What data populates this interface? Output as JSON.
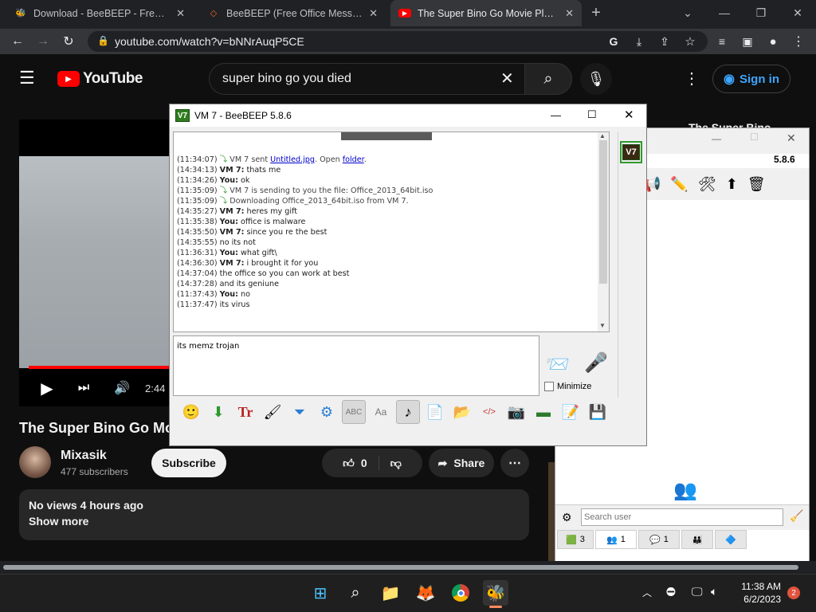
{
  "browser": {
    "tabs": [
      {
        "title": "Download - BeeBEEP - Free Offic",
        "active": false,
        "icon": "beebeep-icon"
      },
      {
        "title": "BeeBEEP (Free Office Messenger)",
        "active": false,
        "icon": "sourceforge-icon"
      },
      {
        "title": "The Super Bino Go Movie Plane",
        "active": true,
        "icon": "youtube-icon"
      }
    ],
    "url": "youtube.com/watch?v=bNNrAuqP5CE"
  },
  "youtube": {
    "logo": "YouTube",
    "search_value": "super bino go you died",
    "sign_in": "Sign in",
    "time": "2:44",
    "video_title": "The Super Bino Go Mo",
    "channel": "Mixasik",
    "subscribers": "477 subscribers",
    "subscribe": "Subscribe",
    "likes": "0",
    "share": "Share",
    "views": "No views  4 hours ago",
    "show_more": "Show more",
    "right_title": "The Super Bino"
  },
  "chat": {
    "title": "VM 7 - BeeBEEP 5.8.6",
    "badge": "V7",
    "messages": [
      {
        "ts": "(11:34:07)",
        "type": "sys",
        "pre": "VM 7 sent ",
        "link1": "Untitled.jpg",
        "mid": ". Open ",
        "link2": "folder",
        "post": "."
      },
      {
        "ts": "(14:34:13)",
        "who": "VM 7:",
        "text": "thats me"
      },
      {
        "ts": "(11:34:26)",
        "who": "You:",
        "text": "ok"
      },
      {
        "ts": "(11:35:09)",
        "type": "sys",
        "pre": "VM 7 is sending to you the file: Office_2013_64bit.iso"
      },
      {
        "ts": "(11:35:09)",
        "type": "sys",
        "pre": "Downloading Office_2013_64bit.iso from VM 7."
      },
      {
        "ts": "(14:35:27)",
        "who": "VM 7:",
        "text": "heres my gift"
      },
      {
        "ts": "(11:35:38)",
        "who": "You:",
        "text": "office is malware"
      },
      {
        "ts": "(14:35:50)",
        "who": "VM 7:",
        "text": "since you re the best"
      },
      {
        "ts": "(14:35:55)",
        "who": "",
        "text": "no its not"
      },
      {
        "ts": "(11:36:31)",
        "who": "You:",
        "text": "what gift\\"
      },
      {
        "ts": "(14:36:30)",
        "who": "VM 7:",
        "text": "i brought it for you"
      },
      {
        "ts": "(14:37:04)",
        "who": "",
        "text": "the office so you can work at best"
      },
      {
        "ts": "(14:37:28)",
        "who": "",
        "text": "and its geniune"
      },
      {
        "ts": "(11:37:43)",
        "who": "You:",
        "text": "no"
      },
      {
        "ts": "(11:37:47)",
        "who": "",
        "text": "its virus"
      }
    ],
    "input_value": "its memz trojan",
    "minimize_label": "Minimize"
  },
  "roster": {
    "version": "5.8.6",
    "search_placeholder": "Search user",
    "tabs": [
      {
        "count": "3",
        "icon": "user-list-icon"
      },
      {
        "count": "1",
        "icon": "group-icon"
      },
      {
        "count": "1",
        "icon": "chat-icon"
      },
      {
        "count": "",
        "icon": "groups-icon"
      },
      {
        "count": "",
        "icon": "share-icon"
      }
    ]
  },
  "taskbar": {
    "time": "11:38 AM",
    "date": "6/2/2023",
    "notifications": "2"
  },
  "colors": {
    "youtube_red": "#ff0000",
    "link_blue": "#3ea6ff",
    "beebeep_green": "#2f7d1f"
  }
}
